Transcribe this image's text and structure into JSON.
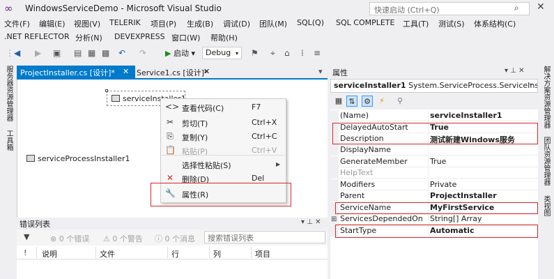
{
  "window": {
    "title": "WindowsServiceDemo - Microsoft Visual Studio",
    "quick_launch_placeholder": "快速启动 (Ctrl+Q)",
    "close_glyph": "✕"
  },
  "menu": {
    "row1": [
      "文件(F)",
      "编辑(E)",
      "视图(V)",
      "TELERIK",
      "项目(P)",
      "生成(B)",
      "调试(D)",
      "团队(M)",
      "SQL(Q)",
      "SQL COMPLETE",
      "工具(T)",
      "测试(S)",
      "体系结构(C)"
    ],
    "row2": [
      ".NET REFLECTOR",
      "分析(N)",
      "DEVEXPRESS",
      "窗口(W)",
      "帮助(H)"
    ]
  },
  "toolbar": {
    "run_label": "启动",
    "config": "Debug"
  },
  "left_strip": {
    "server_explorer": "服务器资源管理器",
    "toolbox": "工具箱"
  },
  "tabs": {
    "active": "ProjectInstaller.cs [设计]*",
    "inactive": "Service1.cs [设计]*",
    "close_glyph": "✕"
  },
  "designer": {
    "service_installer": "serviceInstaller1",
    "process_installer": "serviceProcessInstaller1"
  },
  "context_menu": {
    "items": [
      {
        "label": "查看代码(C)",
        "key": "F7",
        "icon": "<>"
      },
      {
        "label": "剪切(T)",
        "key": "Ctrl+X",
        "icon": "✂"
      },
      {
        "label": "复制(Y)",
        "key": "Ctrl+C",
        "icon": "⎘"
      },
      {
        "label": "粘贴(P)",
        "key": "Ctrl+V",
        "icon": "📋"
      },
      {
        "label": "选择性粘贴(S)",
        "key": "",
        "icon": ""
      },
      {
        "label": "删除(D)",
        "key": "Del",
        "icon": "✕"
      },
      {
        "label": "属性(R)",
        "key": "",
        "icon": "🔧"
      }
    ]
  },
  "error_list": {
    "title": "错误列表",
    "errors": "0 个错误",
    "warnings": "0 个警告",
    "messages": "0 个消息",
    "search_placeholder": "搜索错误列表",
    "columns": [
      "说明",
      "文件",
      "行",
      "列",
      "项目"
    ]
  },
  "properties": {
    "title": "属性",
    "selected_object": "serviceInstaller1",
    "selected_type": "System.ServiceProcess.ServiceInstalle",
    "rows": [
      {
        "name": "(Name)",
        "value": "serviceInstaller1",
        "bold": true
      },
      {
        "name": "DelayedAutoStart",
        "value": "True",
        "bold": true
      },
      {
        "name": "Description",
        "value": "测试新建Windows服务",
        "bold": true
      },
      {
        "name": "DisplayName",
        "value": "",
        "bold": false
      },
      {
        "name": "GenerateMember",
        "value": "True",
        "bold": false
      },
      {
        "name": "HelpText",
        "value": "",
        "bold": false
      },
      {
        "name": "Modifiers",
        "value": "Private",
        "bold": false
      },
      {
        "name": "Parent",
        "value": "ProjectInstaller",
        "bold": true
      },
      {
        "name": "ServiceName",
        "value": "MyFirstService",
        "bold": true
      },
      {
        "name": "ServicesDependedOn",
        "value": "String[] Array",
        "bold": false
      },
      {
        "name": "StartType",
        "value": "Automatic",
        "bold": true
      }
    ]
  },
  "right_strip": {
    "solution_explorer": "解决方案资源管理器",
    "team_explorer": "团队资源管理器",
    "class_view": "类视图"
  },
  "colors": {
    "accent": "#007acc",
    "highlight": "#d9262a"
  }
}
